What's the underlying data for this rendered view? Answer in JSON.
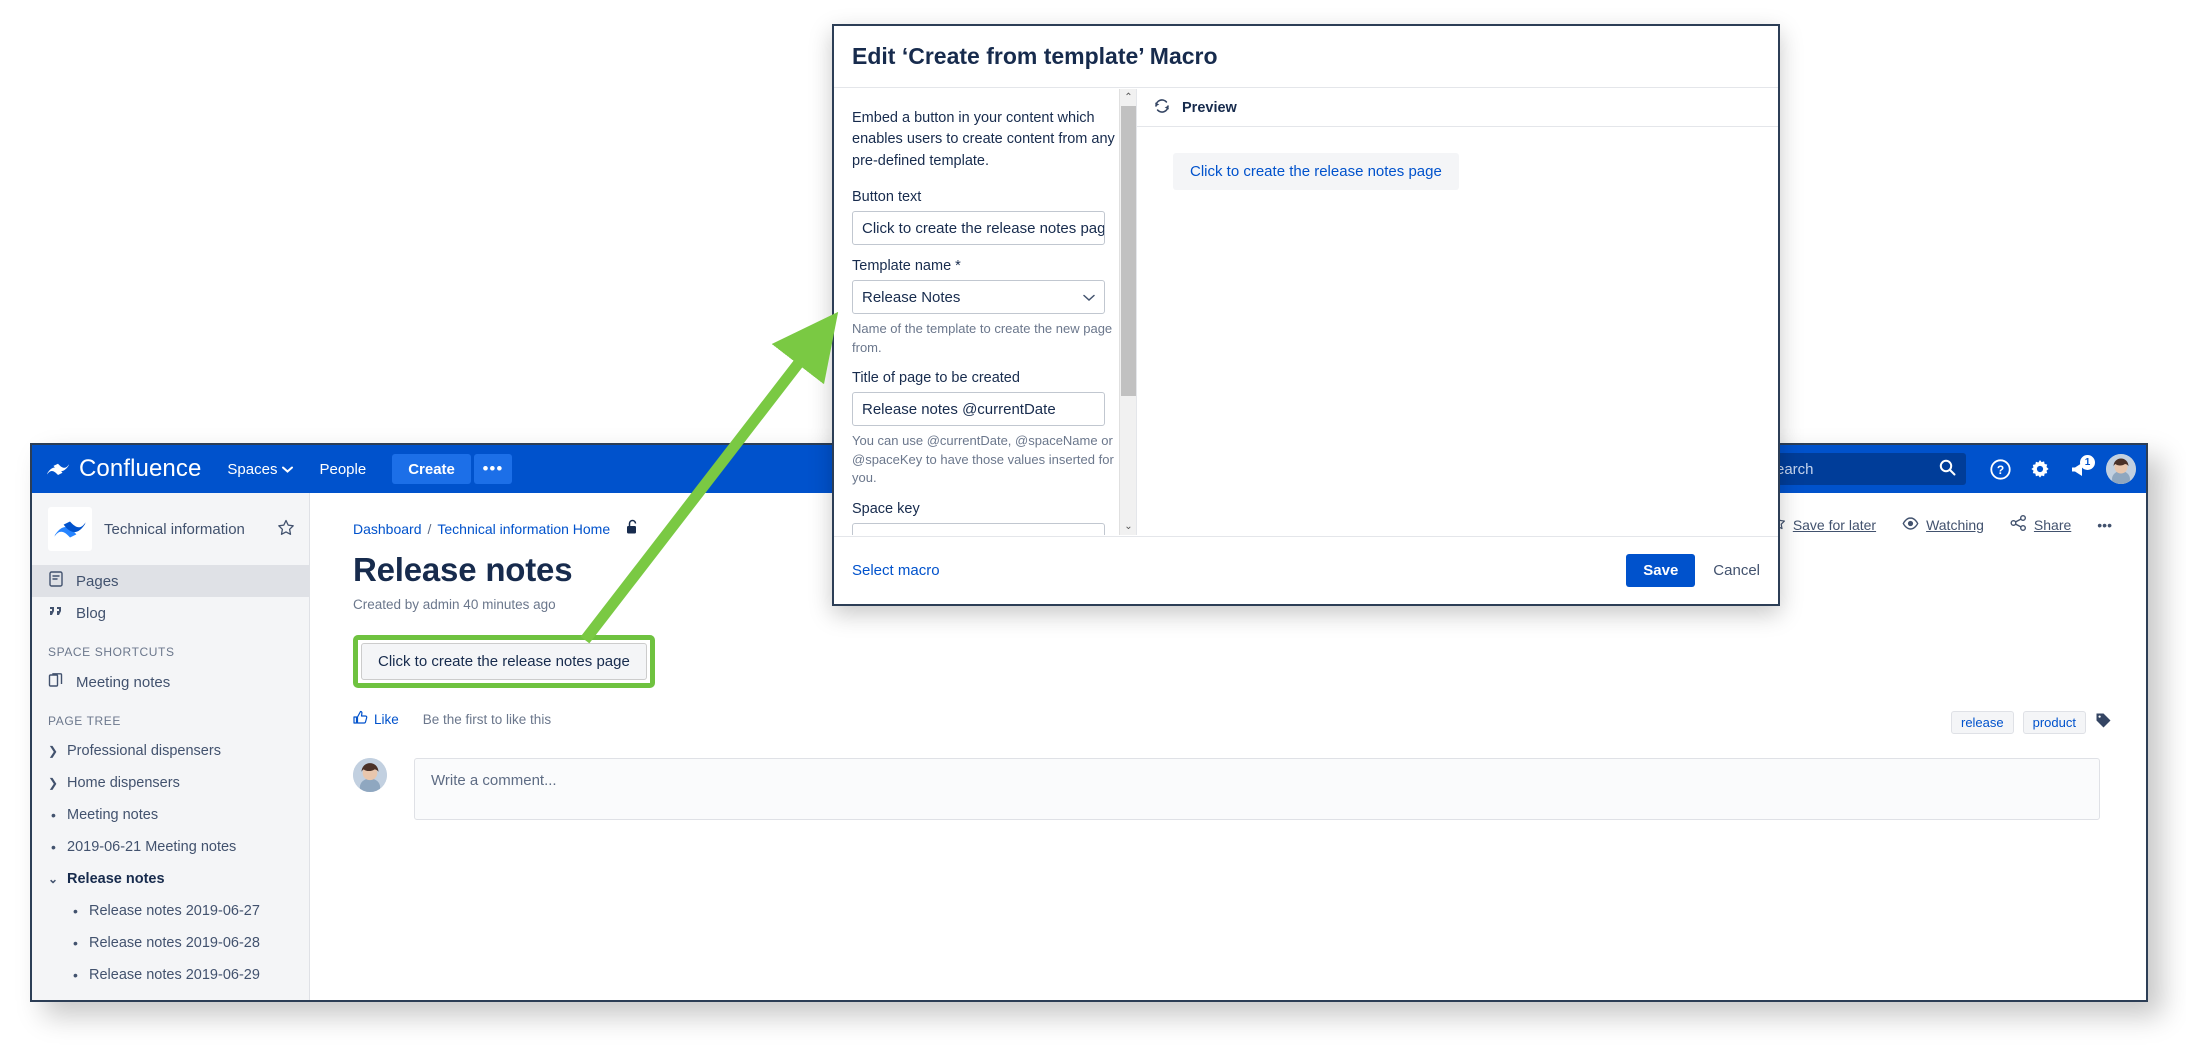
{
  "dialog": {
    "title": "Edit ‘Create from template’ Macro",
    "intro": "Embed a button in your content which enables users to create content from any pre-defined template.",
    "fields": {
      "button_text": {
        "label": "Button text",
        "value": "Click to create the release notes pag"
      },
      "template_name": {
        "label": "Template name *",
        "value": "Release Notes",
        "help": "Name of the template to create the new page from."
      },
      "page_title": {
        "label": "Title of page to be created",
        "value": "Release notes @currentDate",
        "help": "You can use @currentDate, @spaceName or @spaceKey to have those values inserted for you."
      },
      "space_key": {
        "label": "Space key",
        "value": ""
      }
    },
    "preview": {
      "heading": "Preview",
      "button_label": "Click to create the release notes page",
      "refresh_icon": "refresh-icon"
    },
    "footer": {
      "select_macro": "Select macro",
      "save": "Save",
      "cancel": "Cancel"
    },
    "scrollbar": {
      "up_glyph": "⌃",
      "down_glyph": "⌄"
    }
  },
  "topnav": {
    "brand": "Confluence",
    "spaces": "Spaces",
    "people": "People",
    "create": "Create",
    "more": "•••",
    "search_placeholder": "Search",
    "search_visible_text": "earch",
    "notification_count": "1",
    "icons": {
      "search": "search-icon",
      "help": "help-icon",
      "settings": "gear-icon",
      "notifications": "megaphone-icon",
      "avatar": "avatar"
    }
  },
  "sidebar": {
    "space_name": "Technical information",
    "star": "star-icon",
    "items": [
      {
        "label": "Pages",
        "icon": "page-icon",
        "active": true
      },
      {
        "label": "Blog",
        "icon": "quote-icon",
        "active": false
      }
    ],
    "shortcuts_heading": "SPACE SHORTCUTS",
    "shortcuts": [
      {
        "label": "Meeting notes",
        "icon": "copy-icon"
      }
    ],
    "tree_heading": "PAGE TREE",
    "tree": [
      {
        "label": "Professional dispensers",
        "marker": "chevron-right",
        "level": 0,
        "bold": false
      },
      {
        "label": "Home dispensers",
        "marker": "chevron-right",
        "level": 0,
        "bold": false
      },
      {
        "label": "Meeting notes",
        "marker": "bullet",
        "level": 0,
        "bold": false
      },
      {
        "label": "2019-06-21 Meeting notes",
        "marker": "bullet",
        "level": 0,
        "bold": false
      },
      {
        "label": "Release notes",
        "marker": "chevron-down",
        "level": 0,
        "bold": true
      },
      {
        "label": "Release notes 2019-06-27",
        "marker": "bullet",
        "level": 1,
        "bold": false
      },
      {
        "label": "Release notes 2019-06-28",
        "marker": "bullet",
        "level": 1,
        "bold": false
      },
      {
        "label": "Release notes 2019-06-29",
        "marker": "bullet",
        "level": 1,
        "bold": false
      }
    ]
  },
  "page": {
    "breadcrumb": {
      "root": "Dashboard",
      "separator": "/",
      "parent": "Technical information Home",
      "lock_icon": "unlocked-padlock-icon"
    },
    "title": "Release notes",
    "meta": "Created by admin 40 minutes ago",
    "macro_button_label": "Click to create the release notes page",
    "like_label": "Like",
    "like_note": "Be the first to like this",
    "actions": [
      {
        "label": "Save for later",
        "icon": "star-icon"
      },
      {
        "label": "Watching",
        "icon": "eye-icon"
      },
      {
        "label": "Share",
        "icon": "share-icon"
      },
      {
        "label": "•••",
        "icon": "more-icon"
      }
    ],
    "labels": [
      "release",
      "product"
    ],
    "label_icon": "tag-icon",
    "comment_placeholder": "Write a comment..."
  },
  "colors": {
    "nav_blue": "#0052CC",
    "link_blue": "#0052CC",
    "highlight_green": "#6fc23f",
    "dialog_border": "#2c3e56"
  }
}
